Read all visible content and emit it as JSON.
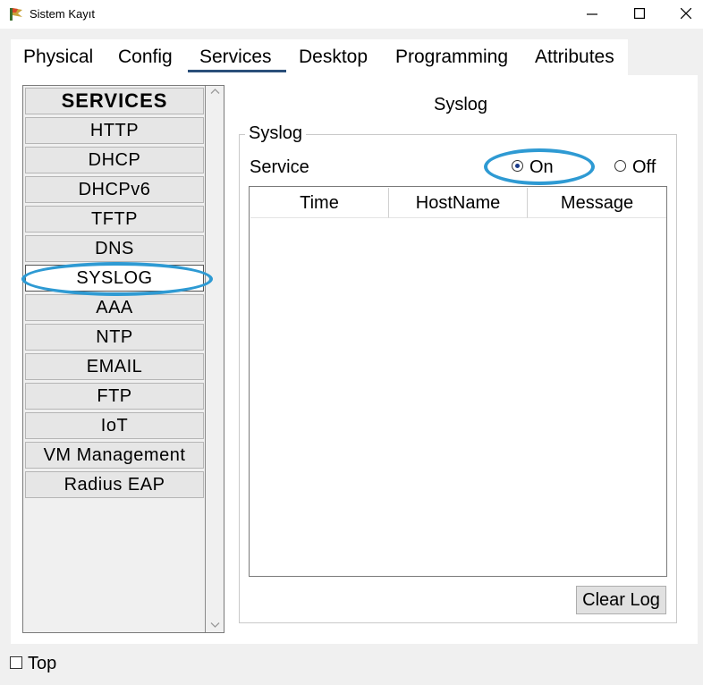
{
  "window": {
    "title": "Sistem Kayıt"
  },
  "tabs": [
    {
      "label": "Physical"
    },
    {
      "label": "Config"
    },
    {
      "label": "Services",
      "active": true
    },
    {
      "label": "Desktop"
    },
    {
      "label": "Programming"
    },
    {
      "label": "Attributes"
    }
  ],
  "sidebar": {
    "header": "SERVICES",
    "items": [
      {
        "label": "HTTP"
      },
      {
        "label": "DHCP"
      },
      {
        "label": "DHCPv6"
      },
      {
        "label": "TFTP"
      },
      {
        "label": "DNS"
      },
      {
        "label": "SYSLOG",
        "selected": true
      },
      {
        "label": "AAA"
      },
      {
        "label": "NTP"
      },
      {
        "label": "EMAIL"
      },
      {
        "label": "FTP"
      },
      {
        "label": "IoT"
      },
      {
        "label": "VM Management"
      },
      {
        "label": "Radius EAP"
      }
    ]
  },
  "content": {
    "title": "Syslog",
    "group_label": "Syslog",
    "service_label": "Service",
    "radio_on": "On",
    "radio_off": "Off",
    "service_state": "On",
    "columns": [
      "Time",
      "HostName",
      "Message"
    ],
    "clear_button": "Clear Log"
  },
  "bottom": {
    "top_checkbox": "Top",
    "checked": false
  },
  "colors": {
    "highlight": "#2e9ad3",
    "active_tab_underline": "#2a4f7a"
  }
}
